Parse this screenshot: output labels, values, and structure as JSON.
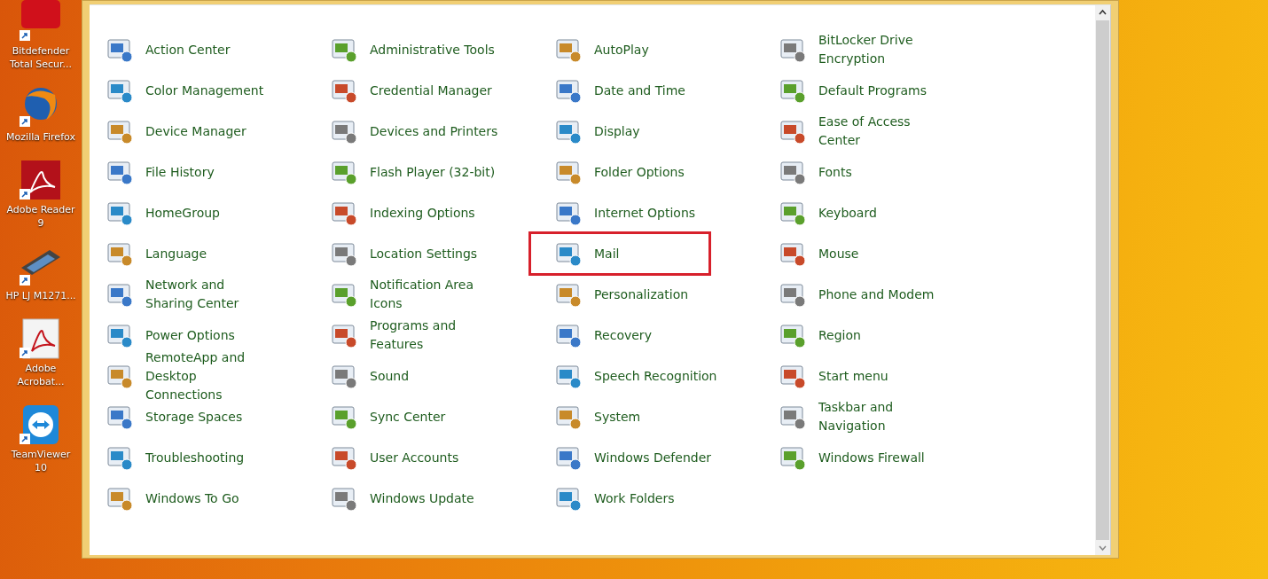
{
  "desktop_icons": [
    {
      "label": "Bitdefender Total Secur...",
      "kind": "tile"
    },
    {
      "label": "Mozilla Firefox",
      "kind": "globe"
    },
    {
      "label": "Adobe Reader 9",
      "kind": "reader"
    },
    {
      "label": "HP LJ M1271...",
      "kind": "scanner"
    },
    {
      "label": "Adobe Acrobat...",
      "kind": "acrobat"
    },
    {
      "label": "TeamViewer 10",
      "kind": "teamviewer"
    }
  ],
  "control_panel": {
    "items": [
      {
        "label": "Action Center",
        "highlighted": false
      },
      {
        "label": "Administrative Tools",
        "highlighted": false
      },
      {
        "label": "AutoPlay",
        "highlighted": false
      },
      {
        "label": "BitLocker Drive Encryption",
        "highlighted": false
      },
      {
        "label": "Color Management",
        "highlighted": false
      },
      {
        "label": "Credential Manager",
        "highlighted": false
      },
      {
        "label": "Date and Time",
        "highlighted": false
      },
      {
        "label": "Default Programs",
        "highlighted": false
      },
      {
        "label": "Device Manager",
        "highlighted": false
      },
      {
        "label": "Devices and Printers",
        "highlighted": false
      },
      {
        "label": "Display",
        "highlighted": false
      },
      {
        "label": "Ease of Access Center",
        "highlighted": false
      },
      {
        "label": "File History",
        "highlighted": false
      },
      {
        "label": "Flash Player (32-bit)",
        "highlighted": false
      },
      {
        "label": "Folder Options",
        "highlighted": false
      },
      {
        "label": "Fonts",
        "highlighted": false
      },
      {
        "label": "HomeGroup",
        "highlighted": false
      },
      {
        "label": "Indexing Options",
        "highlighted": false
      },
      {
        "label": "Internet Options",
        "highlighted": false
      },
      {
        "label": "Keyboard",
        "highlighted": false
      },
      {
        "label": "Language",
        "highlighted": false
      },
      {
        "label": "Location Settings",
        "highlighted": false
      },
      {
        "label": "Mail",
        "highlighted": true
      },
      {
        "label": "Mouse",
        "highlighted": false
      },
      {
        "label": "Network and Sharing Center",
        "highlighted": false
      },
      {
        "label": "Notification Area Icons",
        "highlighted": false
      },
      {
        "label": "Personalization",
        "highlighted": false
      },
      {
        "label": "Phone and Modem",
        "highlighted": false
      },
      {
        "label": "Power Options",
        "highlighted": false
      },
      {
        "label": "Programs and Features",
        "highlighted": false
      },
      {
        "label": "Recovery",
        "highlighted": false
      },
      {
        "label": "Region",
        "highlighted": false
      },
      {
        "label": "RemoteApp and Desktop Connections",
        "highlighted": false
      },
      {
        "label": "Sound",
        "highlighted": false
      },
      {
        "label": "Speech Recognition",
        "highlighted": false
      },
      {
        "label": "Start menu",
        "highlighted": false
      },
      {
        "label": "Storage Spaces",
        "highlighted": false
      },
      {
        "label": "Sync Center",
        "highlighted": false
      },
      {
        "label": "System",
        "highlighted": false
      },
      {
        "label": "Taskbar and Navigation",
        "highlighted": false
      },
      {
        "label": "Troubleshooting",
        "highlighted": false
      },
      {
        "label": "User Accounts",
        "highlighted": false
      },
      {
        "label": "Windows Defender",
        "highlighted": false
      },
      {
        "label": "Windows Firewall",
        "highlighted": false
      },
      {
        "label": "Windows To Go",
        "highlighted": false
      },
      {
        "label": "Windows Update",
        "highlighted": false
      },
      {
        "label": "Work Folders",
        "highlighted": false
      }
    ]
  }
}
